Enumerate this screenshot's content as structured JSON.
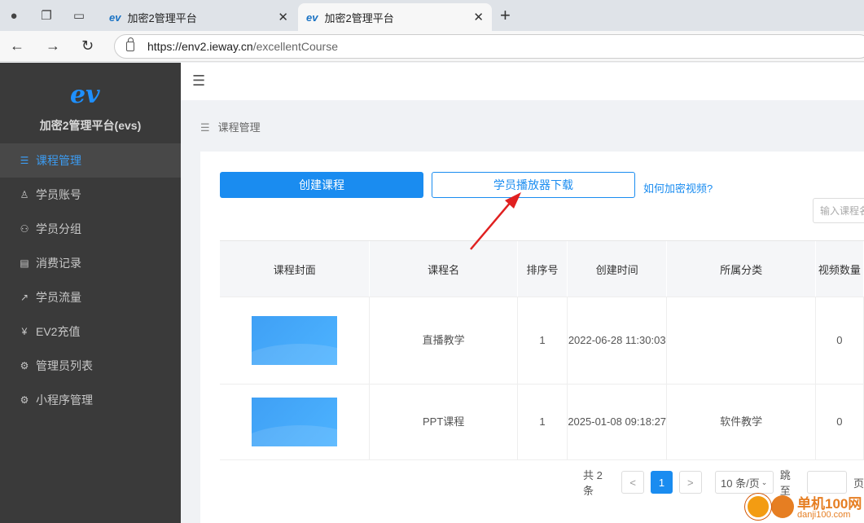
{
  "browser": {
    "tabs": [
      {
        "label": "加密2管理平台",
        "close": "✕"
      },
      {
        "label": "加密2管理平台",
        "close": "✕"
      }
    ],
    "new_tab": "+",
    "url_host": "https://env2.ieway.cn",
    "url_path": "/excellentCourse"
  },
  "sidebar": {
    "logo": "ev",
    "brand": "加密2管理平台(evs)",
    "items": [
      {
        "label": "课程管理",
        "icon": "list-icon"
      },
      {
        "label": "学员账号",
        "icon": "user-icon"
      },
      {
        "label": "学员分组",
        "icon": "group-icon"
      },
      {
        "label": "消费记录",
        "icon": "document-icon"
      },
      {
        "label": "学员流量",
        "icon": "chart-icon"
      },
      {
        "label": "EV2充值",
        "icon": "yen-icon"
      },
      {
        "label": "管理员列表",
        "icon": "gear-icon"
      },
      {
        "label": "小程序管理",
        "icon": "gear-icon"
      }
    ]
  },
  "breadcrumb": "课程管理",
  "toolbar": {
    "create": "创建课程",
    "download": "学员播放器下载",
    "howto": "如何加密视频?",
    "search_placeholder": "输入课程名"
  },
  "table": {
    "headers": [
      "课程封面",
      "课程名",
      "排序号",
      "创建时间",
      "所属分类",
      "视频数量"
    ],
    "rows": [
      {
        "name": "直播教学",
        "order": "1",
        "time": "2022-06-28 11:30:03",
        "category": "",
        "count": "0"
      },
      {
        "name": "PPT课程",
        "order": "1",
        "time": "2025-01-08 09:18:27",
        "category": "软件教学",
        "count": "0"
      }
    ]
  },
  "pagination": {
    "total": "共 2 条",
    "prev": "<",
    "current": "1",
    "next": ">",
    "page_size": "10 条/页",
    "jump": "跳至",
    "page_unit": "页"
  },
  "watermark": {
    "line1": "单机100网",
    "line2": "danji100.com"
  },
  "colors": {
    "accent": "#1a8cf0",
    "sidebar_bg": "#3a3a3a",
    "arrow": "#e02020"
  }
}
